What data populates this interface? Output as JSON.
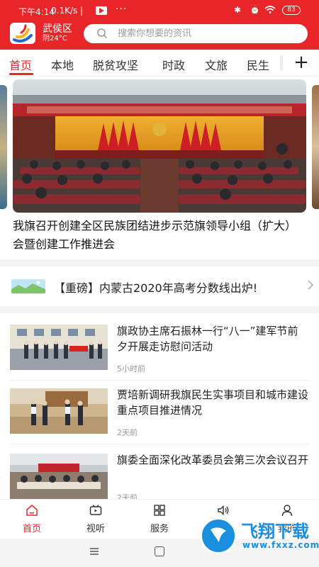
{
  "status_bar": {
    "time": "下午4:14",
    "network": "0.1K/s",
    "battery": "83"
  },
  "header": {
    "region_name": "武侯区",
    "weather": "阴24°C",
    "search_placeholder": "搜索你想要的资讯"
  },
  "tabs": [
    "首页",
    "本地",
    "脱贫攻坚",
    "时政",
    "文旅",
    "民生"
  ],
  "carousel": {
    "hero_title": "我旗召开创建全区民族团结进步示范旗领导小组（扩大）会暨创建工作推进会"
  },
  "ticker": {
    "text": "【重磅】内蒙古2020年高考分数线出炉!"
  },
  "news": [
    {
      "title": "旗政协主席石振林一行“八一”建军节前夕开展走访慰问活动",
      "time": "5小时前"
    },
    {
      "title": "贾培新调研我旗民生实事项目和城市建设重点项目推进情况",
      "time": "2天前"
    },
    {
      "title": "旗委全面深化改革委员会第三次会议召开",
      "time": "2天前"
    }
  ],
  "bottom_nav": [
    "首页",
    "视听",
    "服务",
    "报料",
    "我的"
  ],
  "watermark": {
    "brand": "飞翔下载",
    "url": "www.fxxz.com"
  },
  "colors": {
    "accent": "#e8262a",
    "watermark": "#1a8fe0"
  }
}
